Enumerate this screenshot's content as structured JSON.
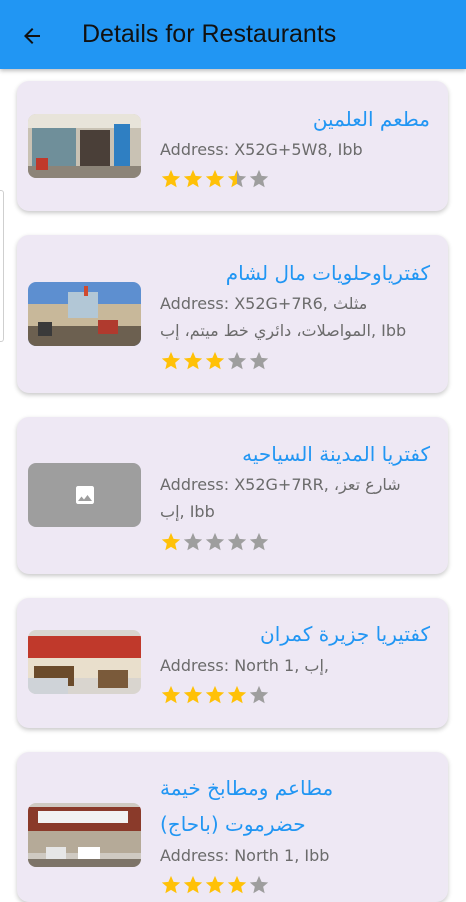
{
  "appbar": {
    "title": "Details for Restaurants",
    "back_icon": "arrow-back-icon",
    "color": "#2196F3"
  },
  "restaurants": [
    {
      "name": "مطعم العلمين",
      "address": "Address: X52G+5W8, Ibb",
      "rating": 3.5
    },
    {
      "name": "كفترياوحلويات مال لشام",
      "address": "Address: X52G+7R6, مثلث المواصلات، دائري خط ميتم، إب, Ibb",
      "rating": 3
    },
    {
      "name": "كفتريا المدينة السياحيه",
      "address": "Address: X52G+7RR, شارع تعز، إب, Ibb",
      "rating": 1
    },
    {
      "name": "كفتيريا جزيرة كمران",
      "address": "Address: North 1, إب,",
      "rating": 4
    },
    {
      "name": "مطاعم ومطابخ خيمة حضرموت (باحاج)",
      "address": "Address: North 1, Ibb",
      "rating": 4
    }
  ],
  "colors": {
    "star_filled": "#FFC107",
    "star_empty": "#9E9E9E",
    "card_bg": "#EEE8F4"
  }
}
